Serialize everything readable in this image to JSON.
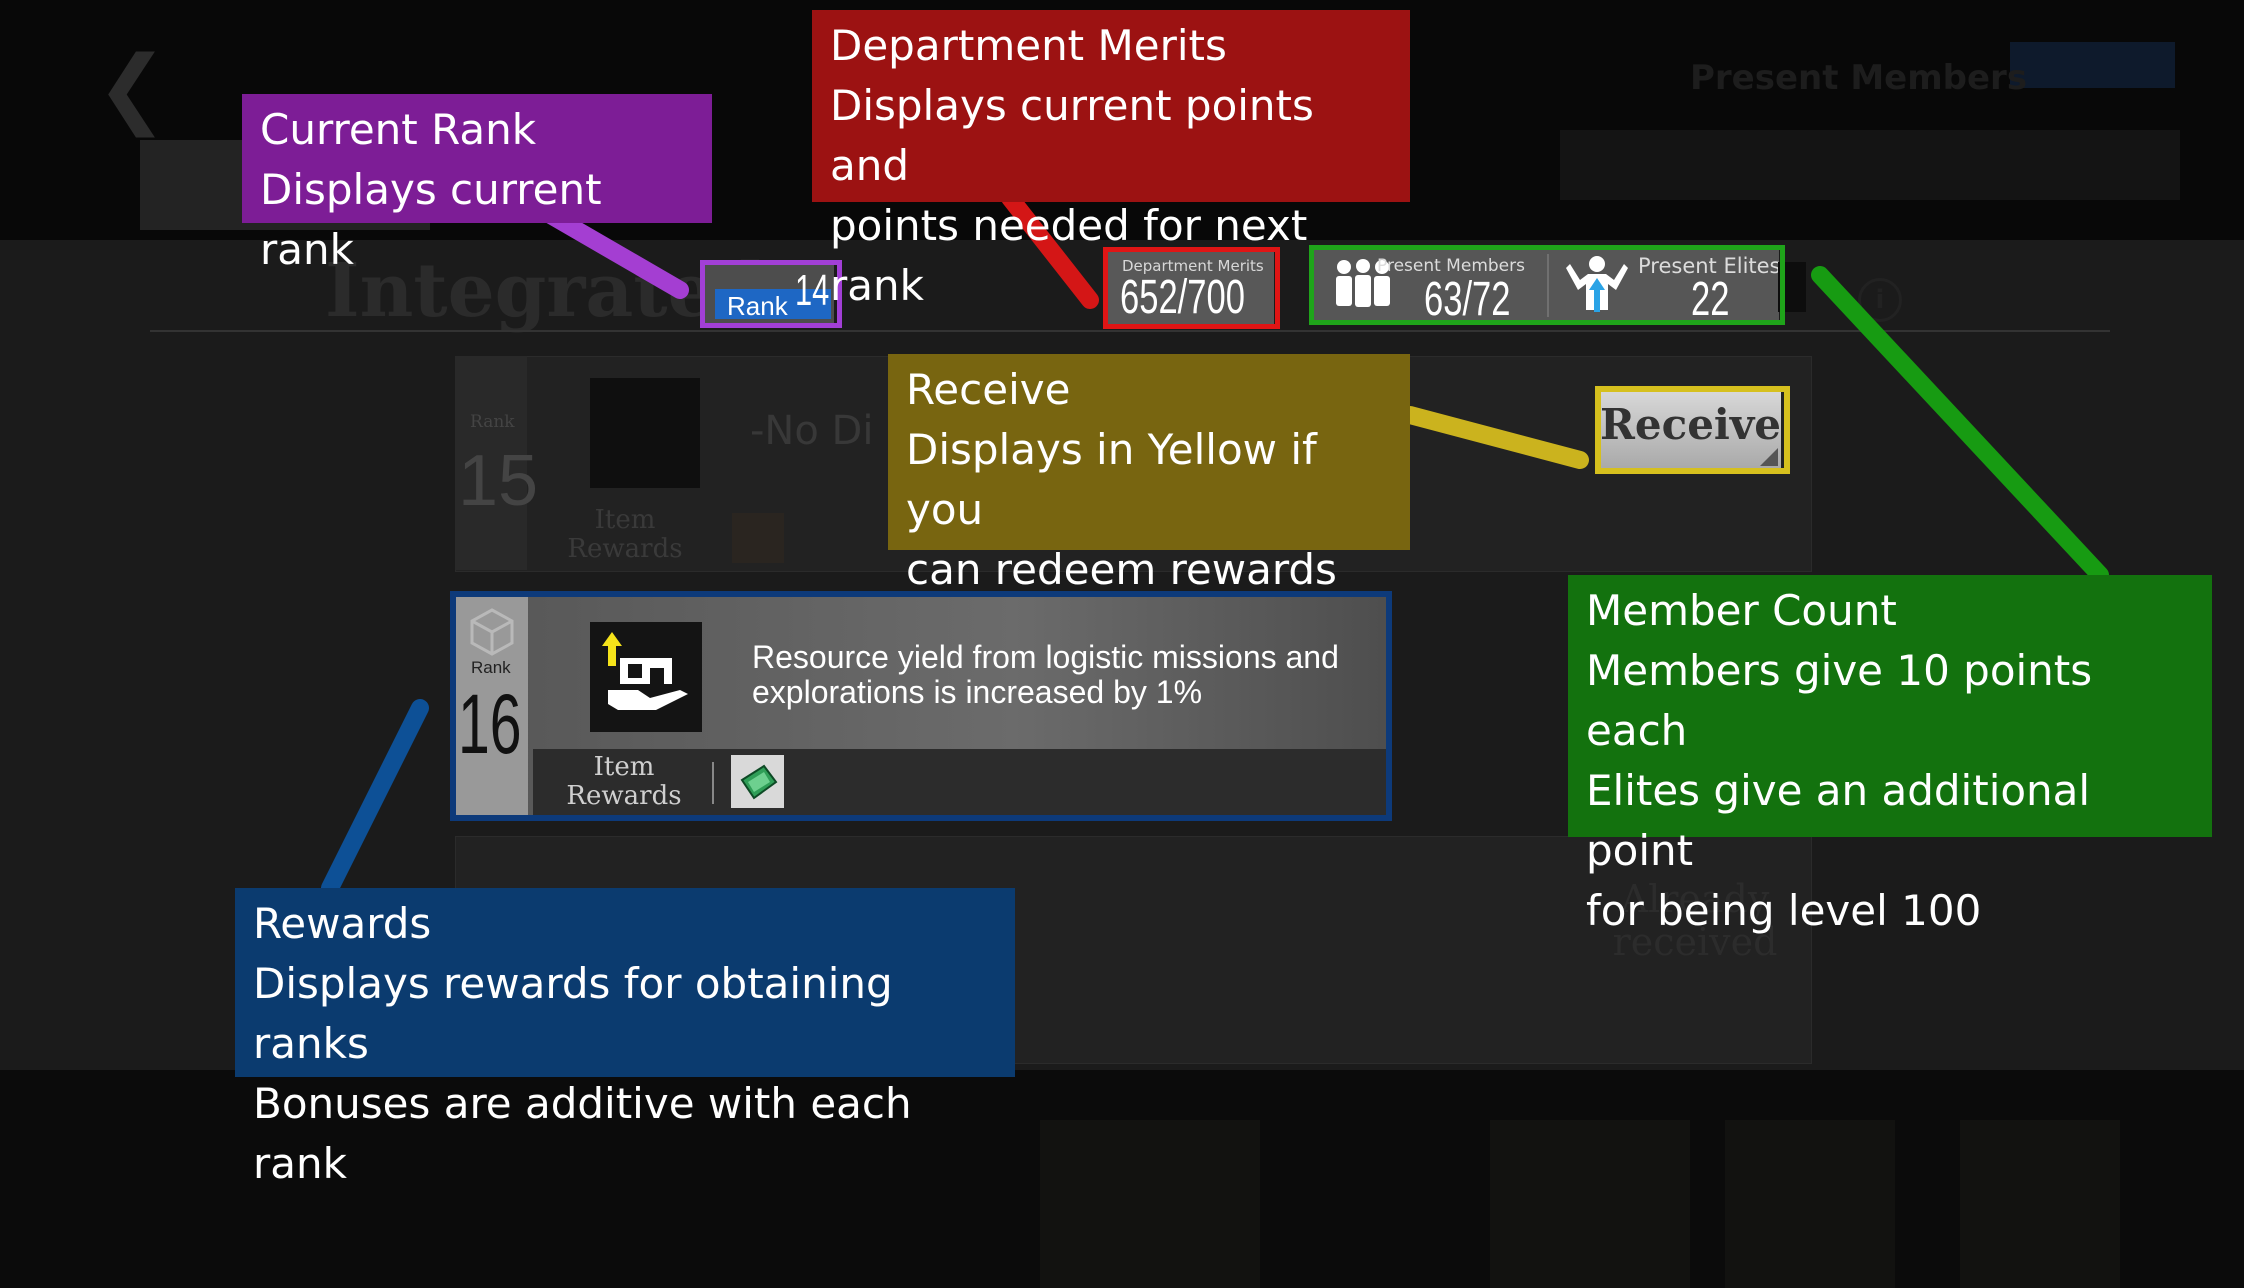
{
  "background": {
    "heading": "Integrated",
    "present_members_banner": "Present Members",
    "dim_row": {
      "rank_label": "Rank",
      "rank_number": "15",
      "description": "-No Di",
      "item_rewards_label": "Item Rewards"
    },
    "dim_row_bottom": {
      "status": "Already received"
    }
  },
  "rank_badge": {
    "label": "Rank",
    "value": "14"
  },
  "department_merits": {
    "title": "Department Merits",
    "value": "652/700"
  },
  "members": {
    "present_members_label": "Present Members",
    "present_members_value": "63/72",
    "present_elites_label": "Present Elites",
    "present_elites_value": "22"
  },
  "receive_button": {
    "label": "Receive"
  },
  "highlighted_row": {
    "rank_label": "Rank",
    "rank_number": "16",
    "description": "Resource yield from logistic missions and explorations is increased by 1%",
    "item_rewards_label": "Item Rewards"
  },
  "callouts": {
    "current_rank": {
      "title": "Current Rank",
      "line1": "Displays current rank"
    },
    "department_merits": {
      "title": "Department Merits",
      "line1": "Displays current points and",
      "line2": "points needed for next rank"
    },
    "receive": {
      "title": "Receive",
      "line1": "Displays in Yellow if you",
      "line2": "can redeem rewards"
    },
    "member_count": {
      "title": "Member Count",
      "line1": "Members give 10 points each",
      "line2": "Elites give an additional point",
      "line3": "for being level 100"
    },
    "rewards": {
      "title": "Rewards",
      "line1": "Displays rewards for obtaining ranks",
      "line2": "Bonuses are additive with each rank"
    }
  },
  "colors": {
    "rank_callout": "#7d1d96",
    "merits_callout": "#9c1212",
    "receive_callout": "#786510",
    "members_callout": "#13720e",
    "rewards_callout": "#0b3b6f"
  }
}
